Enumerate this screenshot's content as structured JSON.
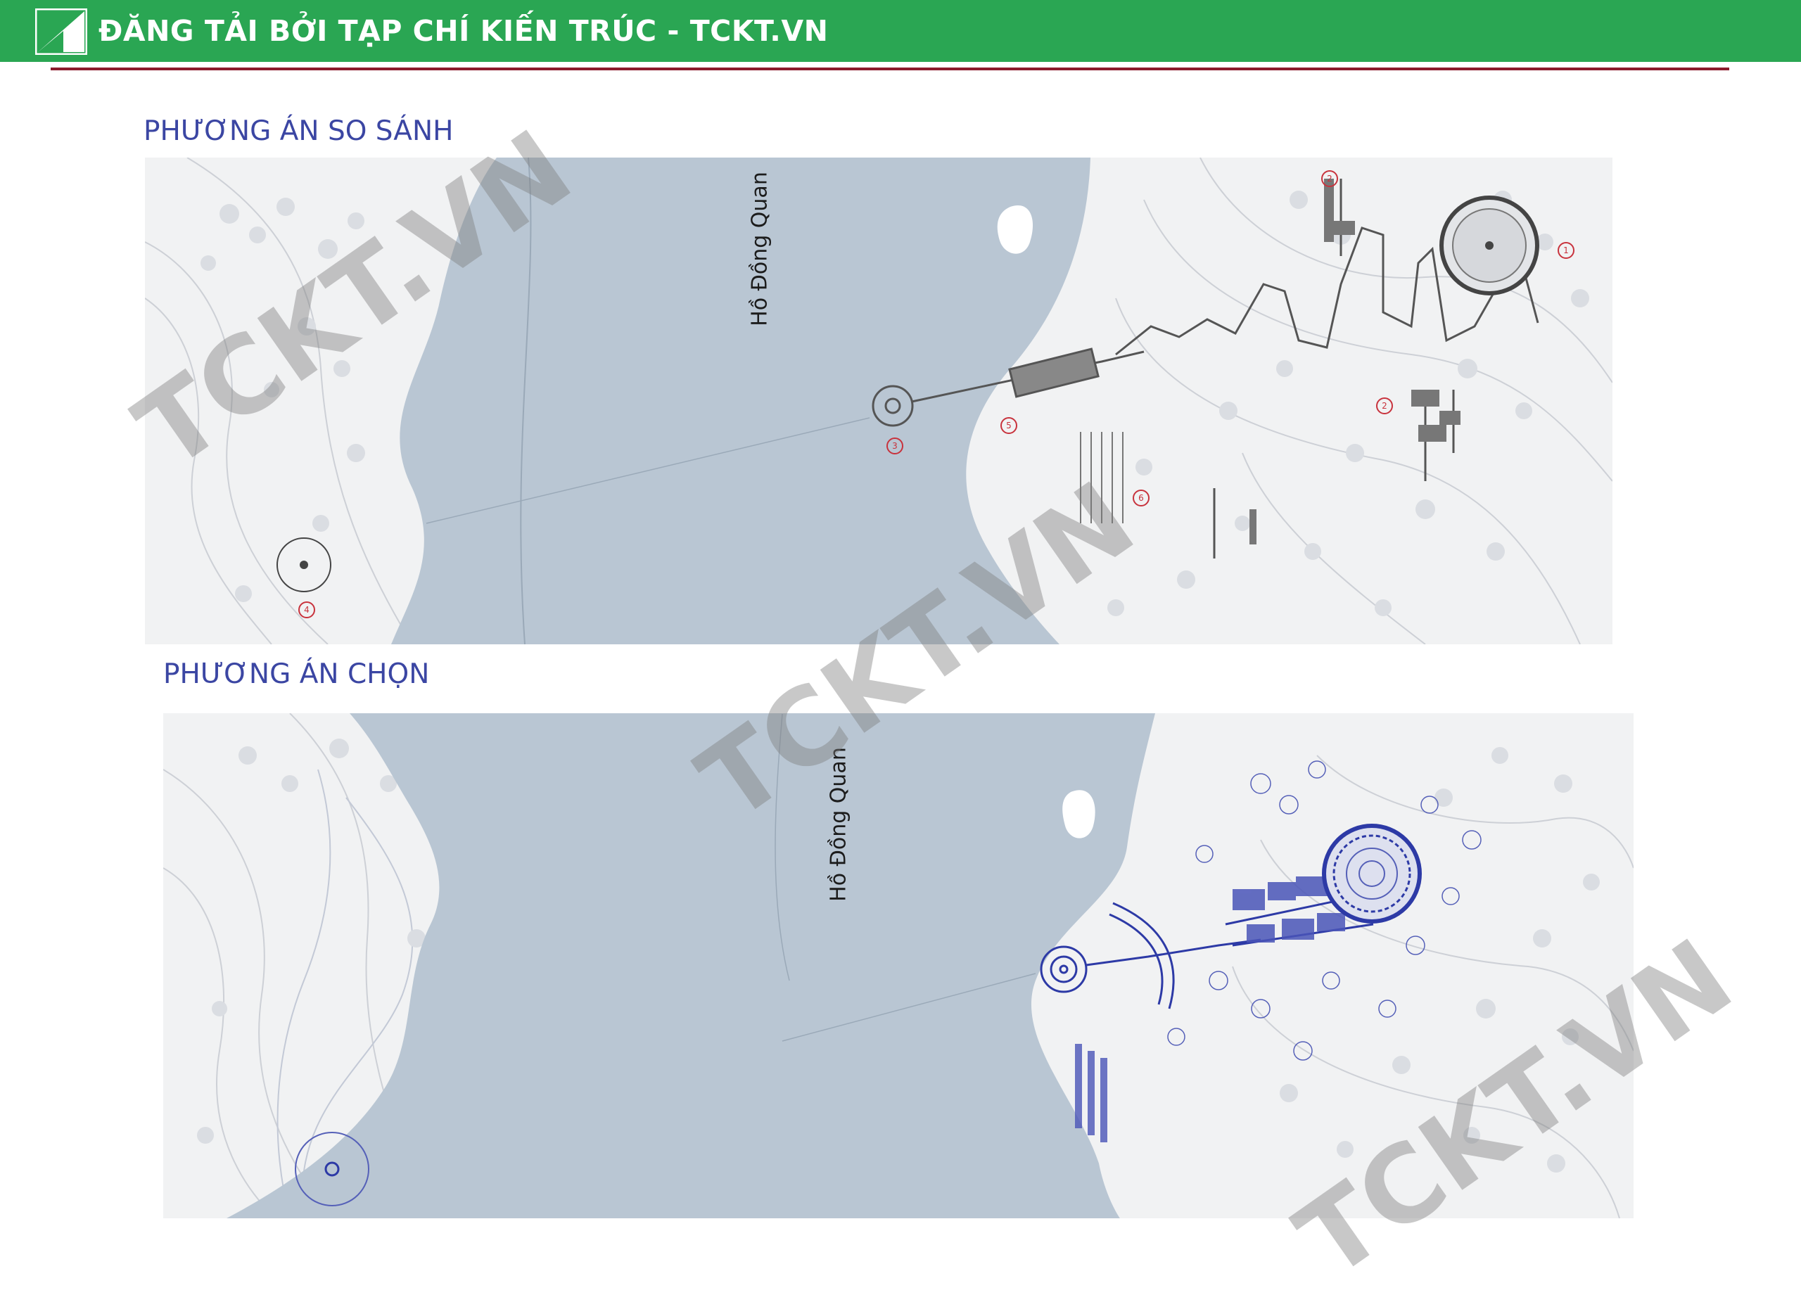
{
  "banner": {
    "text": "ĐĂNG TẢI BỞI TẠP CHÍ KIẾN TRÚC - TCKT.VN",
    "color": "#2aa653",
    "logo_icon": "tckt-logo-icon"
  },
  "sections": [
    {
      "title": "PHƯƠNG ÁN SO SÁNH",
      "lake_label": "Hồ Đồng Quan",
      "markers": [
        "1",
        "2",
        "2",
        "3",
        "4",
        "5",
        "6"
      ]
    },
    {
      "title": "PHƯƠNG ÁN CHỌN",
      "lake_label": "Hồ Đồng Quan"
    }
  ],
  "watermark": "TCKT.VN",
  "colors": {
    "title": "#3b46a3",
    "water": "#b9c6d3",
    "land": "#f1f2f3",
    "structure_blue": "#2d3aa6",
    "marker_red": "#c8323c",
    "rule": "#8b1a2b"
  }
}
